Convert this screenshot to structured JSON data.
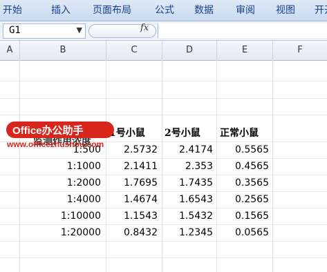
{
  "ribbon": {
    "tabs": [
      "开始",
      "插入",
      "页面布局",
      "公式",
      "数据",
      "审阅",
      "视图",
      "开开"
    ]
  },
  "formula_bar": {
    "name_box": "G1",
    "fx_label": "fx",
    "dropdown_glyph": "▼",
    "formula_value": ""
  },
  "columns": [
    "A",
    "B",
    "C",
    "D",
    "E",
    "F"
  ],
  "table": {
    "headers": [
      "监测作用浓度",
      "1号小鼠",
      "2号小鼠",
      "正常小鼠"
    ],
    "rows": [
      [
        "1:500",
        "2.5732",
        "2.4174",
        "0.5565"
      ],
      [
        "1:1000",
        "2.1411",
        "2.353",
        "0.4565"
      ],
      [
        "1:2000",
        "1.7695",
        "1.7435",
        "0.3565"
      ],
      [
        "1:4000",
        "1.4674",
        "1.6543",
        "0.2565"
      ],
      [
        "1:10000",
        "1.1543",
        "1.5432",
        "0.1565"
      ],
      [
        "1:20000",
        "0.8432",
        "1.2345",
        "0.0565"
      ]
    ]
  },
  "watermark": {
    "brand": "Office办公助手",
    "url": "www.officezhushou.com",
    "color": "#d9261c"
  }
}
